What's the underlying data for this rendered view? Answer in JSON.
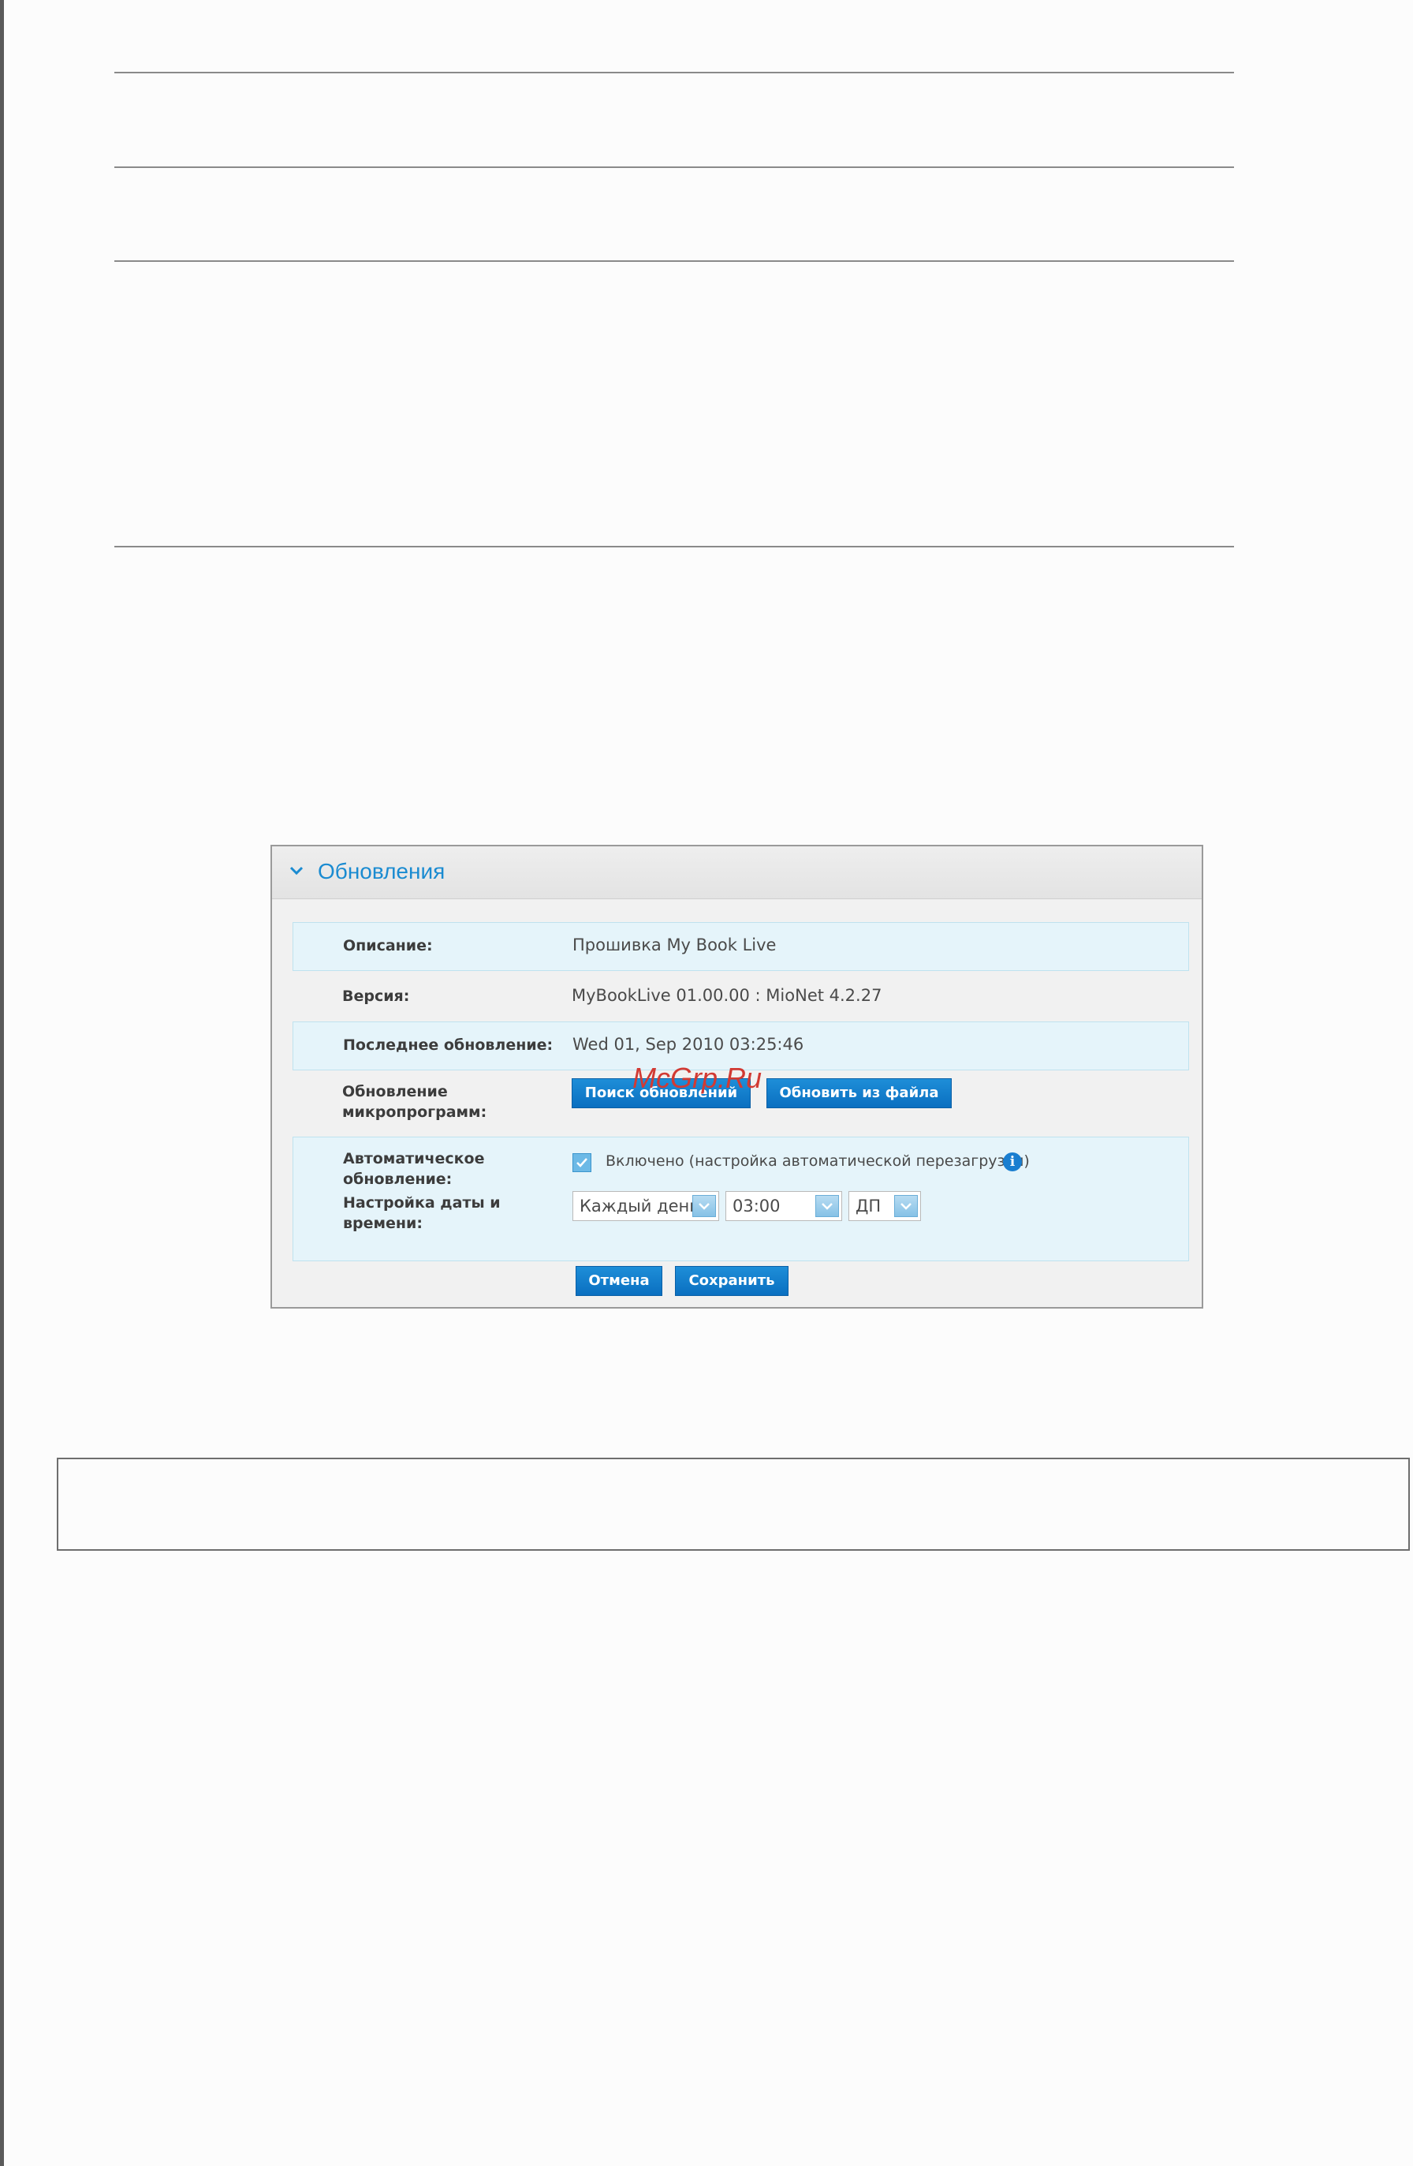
{
  "panel": {
    "title": "Обновления",
    "rows": {
      "description": {
        "label": "Описание:",
        "value": "Прошивка My Book Live"
      },
      "version": {
        "label": "Версия:",
        "value": "MyBookLive 01.00.00 : MioNet 4.2.27"
      },
      "last_update": {
        "label": "Последнее обновление:",
        "value": "Wed 01, Sep 2010 03:25:46"
      },
      "firmware": {
        "label_line1": "Обновление",
        "label_line2": "микропрограмм:",
        "check_button": "Поиск обновлений",
        "file_button": "Обновить из файла"
      },
      "auto_update": {
        "label_line1": "Автоматическое",
        "label_line2": "обновление:",
        "checked": true,
        "checkbox_label": "Включено (настройка автоматической перезагрузки)",
        "info_icon": "info-icon"
      },
      "datetime": {
        "label_line1": "Настройка даты и",
        "label_line2": "времени:",
        "frequency": "Каждый день",
        "time": "03:00",
        "ampm": "ДП"
      }
    },
    "buttons": {
      "cancel": "Отмена",
      "save": "Сохранить"
    }
  },
  "watermark": "McGrp.Ru",
  "colors": {
    "accent": "#1a8bd1",
    "button": "#0a6fc0",
    "row_alt": "#e5f4fa",
    "watermark": "#d23a33"
  }
}
